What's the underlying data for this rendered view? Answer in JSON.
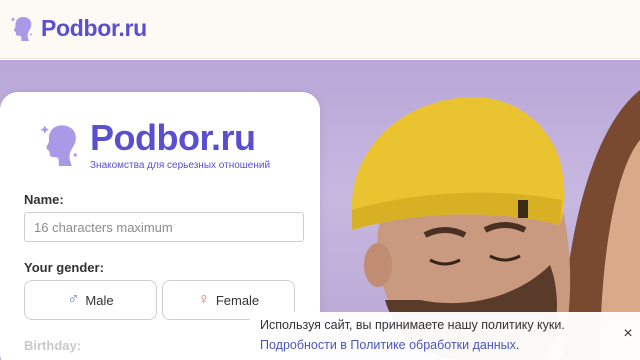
{
  "header": {
    "brand": "Podbor.ru",
    "logo_icon": "woman-silhouette-icon"
  },
  "card": {
    "brand": "Podbor.ru",
    "tagline": "Знакомства для серьезных отношений",
    "name_label": "Name:",
    "name_placeholder": "16 characters maximum",
    "gender_label": "Your gender:",
    "male": {
      "label": "Male",
      "icon": "male-symbol-icon",
      "symbol": "♂"
    },
    "female": {
      "label": "Female",
      "icon": "female-symbol-icon",
      "symbol": "♀"
    },
    "birthday_label": "Birthday:"
  },
  "cookie": {
    "text": "Используя сайт, вы принимаете нашу политику куки.",
    "link_text": "Подробности в Политике обработки данных",
    "link_suffix": ".",
    "close": "×"
  },
  "colors": {
    "brand": "#5a4fcf",
    "male": "#5a79d8",
    "female": "#f0714f",
    "hat": "#e9c330"
  }
}
